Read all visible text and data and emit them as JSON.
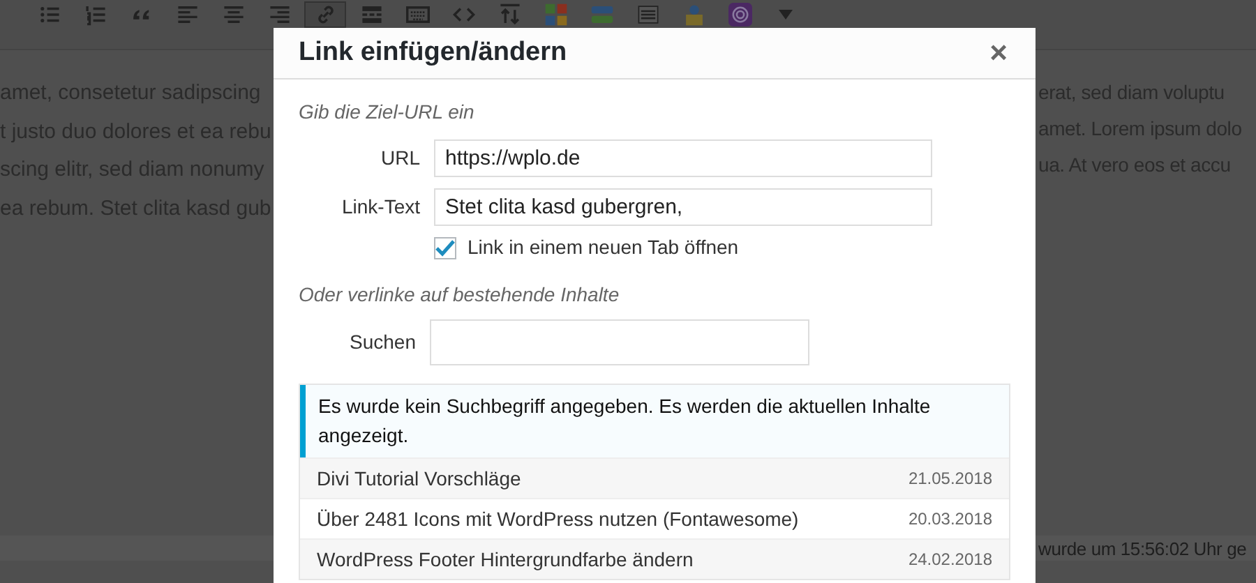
{
  "toolbar": [
    {
      "kind": "bullet-list",
      "active": false
    },
    {
      "kind": "numbered-list",
      "active": false
    },
    {
      "kind": "quote",
      "active": false
    },
    {
      "kind": "align-left",
      "active": false
    },
    {
      "kind": "align-center",
      "active": false
    },
    {
      "kind": "align-right",
      "active": false
    },
    {
      "kind": "link",
      "active": true
    },
    {
      "kind": "read-more",
      "active": false
    },
    {
      "kind": "keyboard",
      "active": false
    },
    {
      "kind": "code",
      "active": false
    },
    {
      "kind": "sort",
      "active": false
    },
    {
      "kind": "color-grid",
      "active": false
    },
    {
      "kind": "bars",
      "active": false
    },
    {
      "kind": "lines",
      "active": false
    },
    {
      "kind": "lock",
      "active": false
    },
    {
      "kind": "plugin",
      "active": false
    },
    {
      "kind": "caret",
      "active": false
    }
  ],
  "editor": {
    "left_lines": [
      "amet, consetetur sadipscing",
      "t justo duo dolores et ea rebu",
      "scing elitr, sed diam nonumy",
      "ea rebum. Stet clita kasd gub"
    ],
    "right_lines": [
      "erat, sed diam voluptu",
      "amet. Lorem ipsum dolo",
      "ua. At vero eos et accu"
    ],
    "status": "wurde um 15:56:02 Uhr ge"
  },
  "dialog": {
    "title": "Link einfügen/ändern",
    "close": "×",
    "url_section": "Gib die Ziel-URL ein",
    "fields": [
      {
        "label": "URL",
        "value": "https://wplo.de"
      },
      {
        "label": "Link-Text",
        "value": "Stet clita kasd gubergren,"
      }
    ],
    "new_tab": {
      "label": "Link in einem neuen Tab öffnen",
      "checked": true
    },
    "search_section": "Oder verlinke auf bestehende Inhalte",
    "search": {
      "label": "Suchen"
    },
    "notice": "Es wurde kein Suchbegriff angegeben. Es werden die aktuellen Inhalte angezeigt.",
    "results": [
      {
        "title": "Divi Tutorial Vorschläge",
        "date": "21.05.2018"
      },
      {
        "title": "Über 2481 Icons mit WordPress nutzen (Fontawesome)",
        "date": "20.03.2018"
      },
      {
        "title": "WordPress Footer Hintergrundfarbe ändern",
        "date": "24.02.2018"
      }
    ]
  }
}
